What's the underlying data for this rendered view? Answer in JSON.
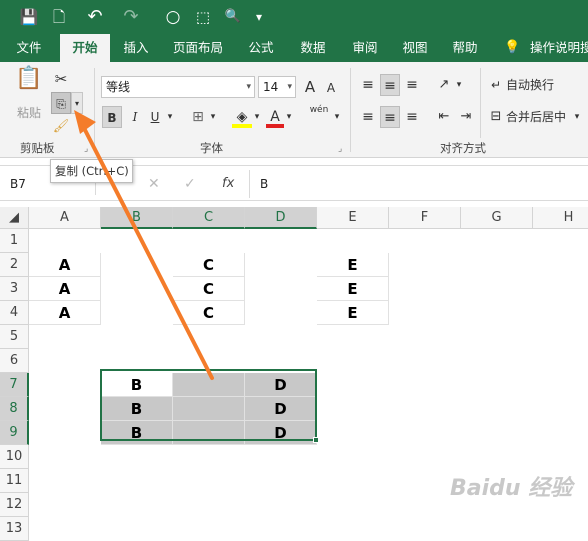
{
  "qat": {
    "save": "💾",
    "new": "🗋",
    "undo": "↶",
    "redo": "↷",
    "circle": "○",
    "shape": "⬚",
    "preview": "🔍",
    "more": "▾"
  },
  "tabs": [
    {
      "label": "文件"
    },
    {
      "label": "开始"
    },
    {
      "label": "插入"
    },
    {
      "label": "页面布局"
    },
    {
      "label": "公式"
    },
    {
      "label": "数据"
    },
    {
      "label": "审阅"
    },
    {
      "label": "视图"
    },
    {
      "label": "帮助"
    },
    {
      "label": "操作说明搜"
    }
  ],
  "ribbon": {
    "paste_label": "粘贴",
    "clipboard_group": "剪贴板",
    "font_group": "字体",
    "align_group": "对齐方式",
    "font_name": "等线",
    "font_size": "14",
    "bold": "B",
    "italic": "I",
    "underline": "U",
    "wrap_text": "自动换行",
    "merge_center": "合并后居中",
    "phonetic": "wén",
    "grow_font": "A",
    "shrink_font": "A",
    "font_color": "A"
  },
  "tooltip": "复制 (Ctrl+C)",
  "formula_bar": {
    "name_box": "B7",
    "cancel": "✕",
    "enter": "✓",
    "fx": "fx",
    "value": "B"
  },
  "columns": [
    "A",
    "B",
    "C",
    "D",
    "E",
    "F",
    "G",
    "H"
  ],
  "rows": [
    "1",
    "2",
    "3",
    "4",
    "5",
    "6",
    "7",
    "8",
    "9",
    "10",
    "11",
    "12",
    "13"
  ],
  "cells": {
    "r2": {
      "A": "A",
      "C": "C",
      "E": "E"
    },
    "r3": {
      "A": "A",
      "C": "C",
      "E": "E"
    },
    "r4": {
      "A": "A",
      "C": "C",
      "E": "E"
    },
    "r7": {
      "B": "B",
      "D": "D"
    },
    "r8": {
      "B": "B",
      "D": "D"
    },
    "r9": {
      "B": "B",
      "D": "D"
    }
  },
  "watermark": "Baidu 经验",
  "accent": "#217346",
  "arrow_color": "#f47c2a"
}
